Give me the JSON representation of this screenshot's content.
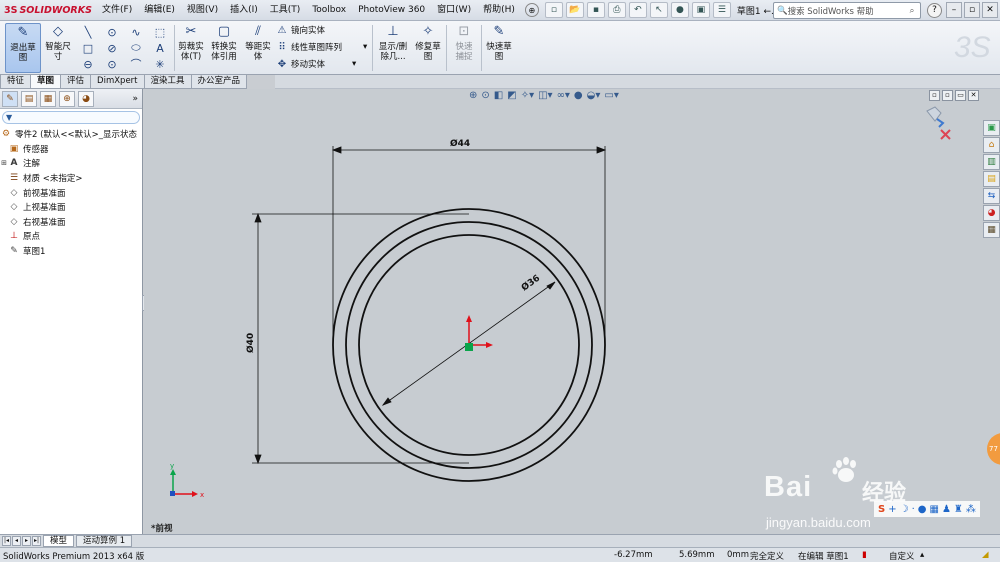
{
  "app": {
    "logo_text": "SOLIDWORKS",
    "logo_mark": "3S"
  },
  "menu": [
    "文件(F)",
    "编辑(E)",
    "视图(V)",
    "插入(I)",
    "工具(T)",
    "Toolbox",
    "PhotoView 360",
    "窗口(W)",
    "帮助(H)"
  ],
  "document_title": "草图1 ←...",
  "search": {
    "placeholder": "搜索 SolidWorks 帮助"
  },
  "command_manager": {
    "exit_sketch": "退出草图",
    "smart_dimension": "智能尺寸",
    "trim": "剪裁实体(T)",
    "convert": "转换实体引用",
    "offset": "等距实体",
    "mirror": "镜向实体",
    "linear_pattern": "线性草图阵列",
    "move": "移动实体",
    "display_delete": "显示/删除几...",
    "repair": "修复草图",
    "quick_snaps": "快速捕捉",
    "rapid_sketch": "快速草图"
  },
  "tabs": [
    "特征",
    "草图",
    "评估",
    "DimXpert",
    "渲染工具",
    "办公室产品"
  ],
  "active_tab": "草图",
  "tree": {
    "root": "零件2 (默认<<默认>_显示状态",
    "items": [
      {
        "label": "传感器",
        "icon": "sensor-icon",
        "expandable": false
      },
      {
        "label": "注解",
        "icon": "annotation-icon",
        "expandable": true
      },
      {
        "label": "材质 <未指定>",
        "icon": "material-icon",
        "expandable": false
      },
      {
        "label": "前视基准面",
        "icon": "plane-icon",
        "expandable": false
      },
      {
        "label": "上视基准面",
        "icon": "plane-icon",
        "expandable": false
      },
      {
        "label": "右视基准面",
        "icon": "plane-icon",
        "expandable": false
      },
      {
        "label": "原点",
        "icon": "origin-icon",
        "expandable": false
      },
      {
        "label": "草图1",
        "icon": "sketch-icon",
        "expandable": false
      }
    ]
  },
  "dimensions": {
    "top": "Ø44",
    "diag": "Ø36",
    "left": "Ø40"
  },
  "axis": {
    "x": "x",
    "y": "y"
  },
  "view_name": "*前视",
  "bottom_tabs": [
    "模型",
    "运动算例 1"
  ],
  "status": {
    "product": "SolidWorks Premium 2013 x64 版",
    "x": "-6.27mm",
    "y": "5.69mm",
    "z": "0mm",
    "state": "完全定义",
    "editing": "在编辑 草图1",
    "units": "自定义"
  },
  "watermark": {
    "brand": "Bai",
    "brand_cn": "经验",
    "url": "jingyan.baidu.com",
    "badge": "77"
  },
  "colors": {
    "accent": "#1c3e78",
    "background": "#c7ccd1",
    "origin_red": "#e0101a",
    "origin_green": "#0aa44a"
  }
}
